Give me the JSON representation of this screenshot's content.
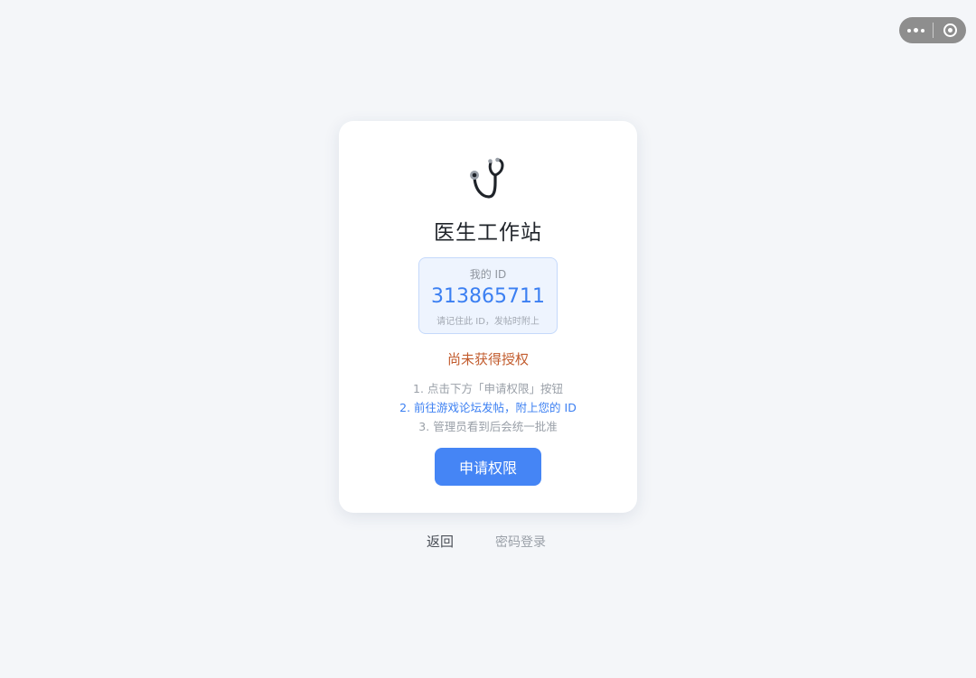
{
  "capsule": {
    "more_icon": "more-dots-icon",
    "close_icon": "circle-close-icon"
  },
  "card": {
    "logo_icon": "stethoscope-icon",
    "title": "医生工作站",
    "id_box": {
      "label": "我的 ID",
      "value": "313865711",
      "hint": "请记住此 ID，发帖时附上"
    },
    "status": "尚未获得授权",
    "steps": [
      "1. 点击下方「申请权限」按钮",
      "2. 前往游戏论坛发帖，附上您的 ID",
      "3. 管理员看到后会统一批准"
    ],
    "apply_button": "申请权限"
  },
  "footer": {
    "back_link": "返回",
    "password_login_link": "密码登录"
  },
  "colors": {
    "accent": "#4585f5",
    "id_text": "#3b7ff2",
    "status": "#c25c2e",
    "background": "#f4f6f9"
  }
}
